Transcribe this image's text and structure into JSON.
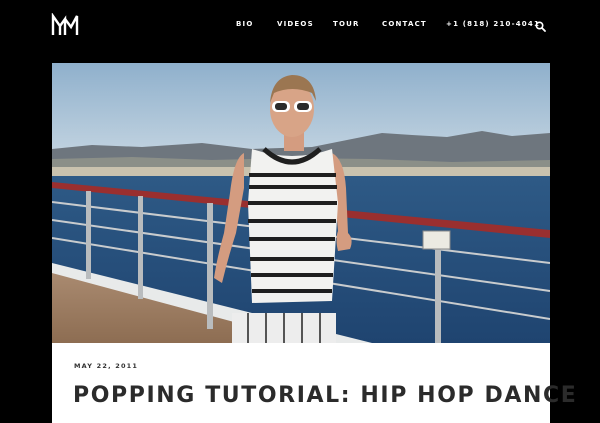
{
  "header": {
    "logo_name": "M-monogram-logo",
    "nav": [
      {
        "label": "BIO"
      },
      {
        "label": "VIDEOS"
      },
      {
        "label": "TOUR"
      },
      {
        "label": "CONTACT"
      },
      {
        "label": "+1 (818) 210-4041"
      }
    ],
    "search_icon": "search-icon"
  },
  "post": {
    "date": "MAY 22, 2011",
    "title": "POPPING TUTORIAL: HIP HOP DANCE"
  },
  "colors": {
    "background": "#000000",
    "card": "#ffffff",
    "title": "#2b2b2b",
    "nav_text": "#ffffff"
  }
}
